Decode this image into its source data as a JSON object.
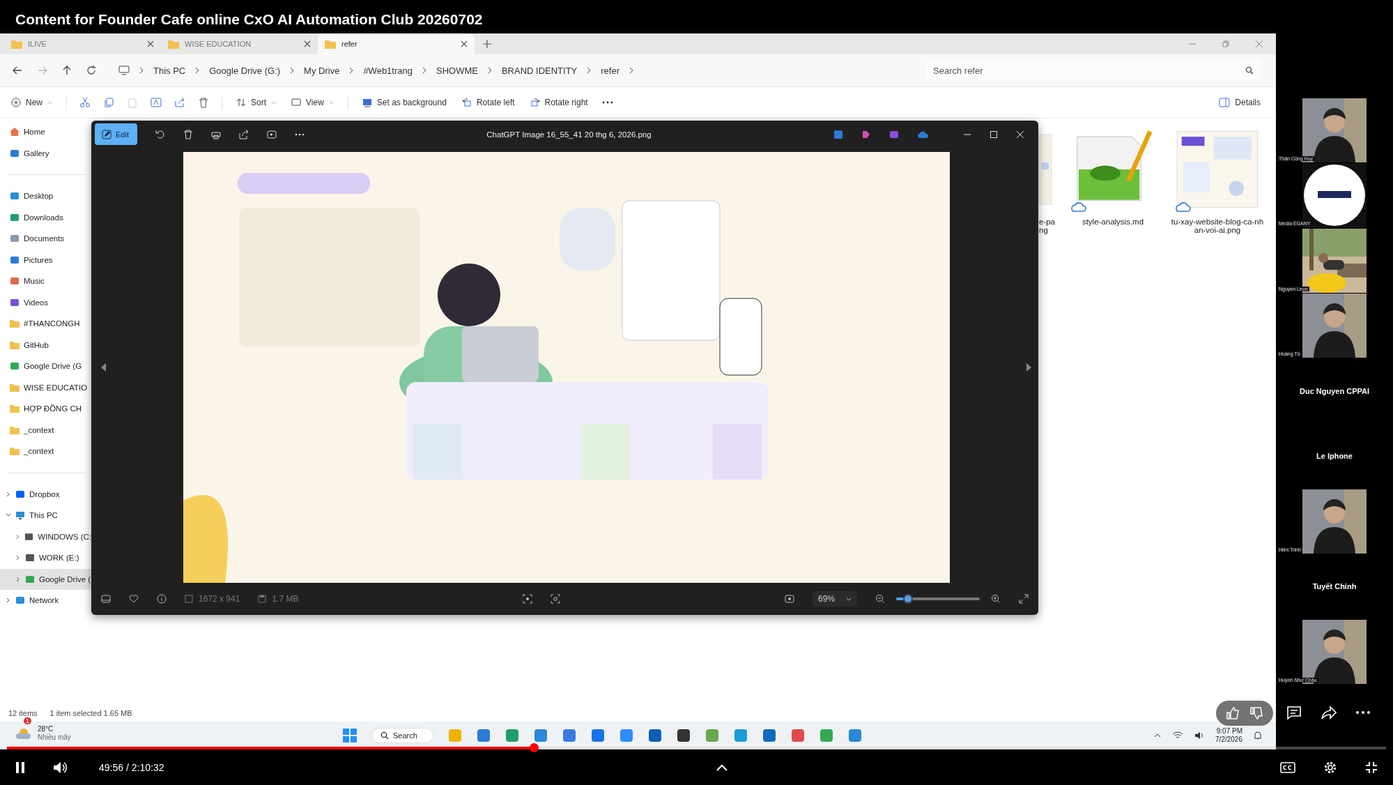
{
  "video_title": "Content for Founder Cafe online CxO AI Automation Club 20260702",
  "explorer": {
    "tabs": [
      {
        "label": "ILIVE",
        "selected": false
      },
      {
        "label": "WISE EDUCATION",
        "selected": false
      },
      {
        "label": "refer",
        "selected": true
      }
    ],
    "breadcrumb": [
      "This PC",
      "Google Drive (G:)",
      "My Drive",
      "#Web1trang",
      "SHOWME",
      "BRAND IDENTITY",
      "refer"
    ],
    "search": {
      "placeholder": "Search refer"
    },
    "toolbar": [
      {
        "label": "New",
        "kind": "dropdown"
      },
      {
        "label": "Sort",
        "kind": "dropdown"
      },
      {
        "label": "View",
        "kind": "dropdown"
      },
      {
        "label": "Set as background",
        "kind": "action"
      },
      {
        "label": "Rotate left",
        "kind": "action"
      },
      {
        "label": "Rotate right",
        "kind": "action"
      }
    ],
    "details": "Details",
    "sidebar": [
      {
        "label": "Home",
        "kind": "home",
        "selected": false
      },
      {
        "label": "Gallery",
        "kind": "gallery",
        "selected": false
      },
      {
        "kind": "divider"
      },
      {
        "label": "Desktop",
        "kind": "desktop",
        "selected": false
      },
      {
        "label": "Downloads",
        "kind": "downloads",
        "selected": false
      },
      {
        "label": "Documents",
        "kind": "documents",
        "selected": false
      },
      {
        "label": "Pictures",
        "kind": "pictures",
        "selected": false
      },
      {
        "label": "Music",
        "kind": "music",
        "selected": false
      },
      {
        "label": "Videos",
        "kind": "videos",
        "selected": false
      },
      {
        "label": "#THANCONGH",
        "kind": "folder",
        "selected": false
      },
      {
        "label": "GitHub",
        "kind": "folder",
        "selected": false
      },
      {
        "label": "Google Drive (G",
        "kind": "gdrive",
        "selected": false
      },
      {
        "label": "WISE EDUCATIO",
        "kind": "folder",
        "selected": false
      },
      {
        "label": "HỢP ĐỒNG CH",
        "kind": "folder",
        "selected": false
      },
      {
        "label": "_context",
        "kind": "folder",
        "selected": false
      },
      {
        "label": "_context",
        "kind": "folder",
        "selected": false
      },
      {
        "kind": "divider"
      },
      {
        "label": "Dropbox",
        "kind": "dropbox",
        "selected": false,
        "expanded": false
      },
      {
        "label": "This PC",
        "kind": "pc",
        "selected": false,
        "expanded": true,
        "children": [
          {
            "label": "WINDOWS (C:",
            "kind": "disk",
            "selected": false,
            "expanded": false
          },
          {
            "label": "WORK (E:)",
            "kind": "disk",
            "selected": false,
            "expanded": false
          },
          {
            "label": "Google Drive (",
            "kind": "gdrive",
            "selected": true,
            "expanded": false
          }
        ]
      },
      {
        "label": "Network",
        "kind": "network",
        "selected": false,
        "expanded": false
      }
    ],
    "files": [
      {
        "name_lines": [
          "e-pa",
          "ng"
        ],
        "kind": "partial"
      },
      {
        "name_lines": [
          "style-analysis.md"
        ],
        "kind": "text"
      },
      {
        "name_lines": [
          "tu-xay-website-blog-ca-nh",
          "an-voi-ai.png"
        ]
      }
    ],
    "status": [
      "12 items",
      "1 item selected  1.65 MB"
    ]
  },
  "viewer": {
    "edit": "Edit",
    "title": "ChatGPT Image 16_55_41 20 thg 6, 2026.png",
    "dimensions": "1672 x 941",
    "size": "1.7 MB",
    "zoom": "69%",
    "zoom_slider": {
      "level": 0.14
    }
  },
  "taskbar": {
    "weather_badge": "1",
    "temperature": "28°C",
    "condition": "Nhiều mây",
    "search": "Search",
    "time": "9:07 PM",
    "date": "7/2/2026"
  },
  "participants": [
    {
      "name": "Thân Công Huy",
      "kind": "video"
    },
    {
      "name": "Media EGANY",
      "kind": "logo"
    },
    {
      "name": "Nguyen Leon",
      "kind": "scene"
    },
    {
      "name": "Hoàng Tô",
      "kind": "video"
    },
    {
      "name": "Duc Nguyen CPPAI",
      "kind": "name"
    },
    {
      "name": "Le Iphone",
      "kind": "name"
    },
    {
      "name": "Hiền Trinh",
      "kind": "video"
    },
    {
      "name": "Tuyết Chinh",
      "kind": "name"
    },
    {
      "name": "Huỳnh Như Châu",
      "kind": "video"
    }
  ],
  "player": {
    "playing": true,
    "time": "49:56 / 2:10:32",
    "progress": {
      "level": 0.382
    }
  }
}
